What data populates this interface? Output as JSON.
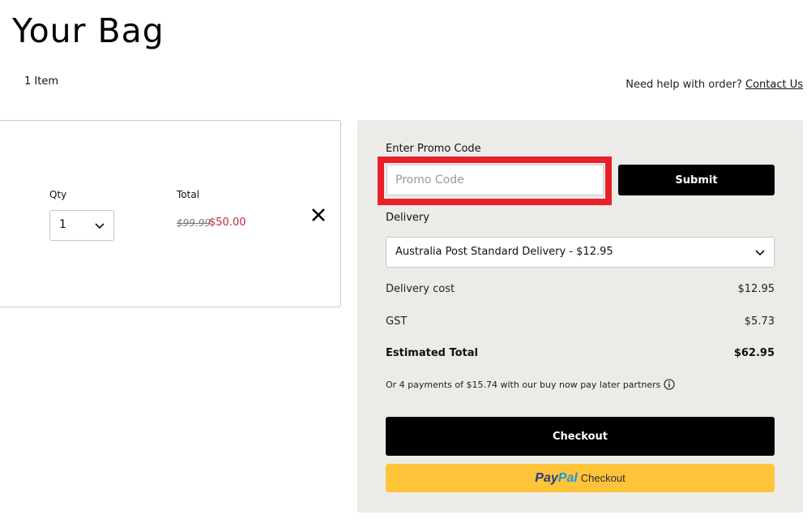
{
  "page": {
    "title": "Your Bag",
    "item_count": "1 Item",
    "help_text": "Need help with order?",
    "help_link": "Contact Us"
  },
  "cart_item": {
    "qty_label": "Qty",
    "qty_value": "1",
    "total_label": "Total",
    "original_price": "$99.99",
    "sale_price": "$50.00",
    "remove_icon": "close-icon"
  },
  "summary": {
    "promo_label": "Enter Promo Code",
    "promo_value": "",
    "promo_placeholder": "Promo Code",
    "submit_label": "Submit",
    "delivery_label": "Delivery",
    "delivery_selected": "Australia Post Standard Delivery - $12.95",
    "rows": [
      {
        "label": "Delivery cost",
        "value": "$12.95"
      },
      {
        "label": "GST",
        "value": "$5.73"
      },
      {
        "label": "Estimated Total",
        "value": "$62.95"
      }
    ],
    "bnpl_text": "Or 4 payments of $15.74 with our buy now pay later partners",
    "checkout_label": "Checkout",
    "paypal": {
      "pay": "Pay",
      "pal": "Pal",
      "label": "Checkout"
    }
  },
  "colors": {
    "sale_price": "#c5283d",
    "highlight": "#e8202a",
    "panel_bg": "#edebe8",
    "paypal_yellow": "#ffc439"
  }
}
